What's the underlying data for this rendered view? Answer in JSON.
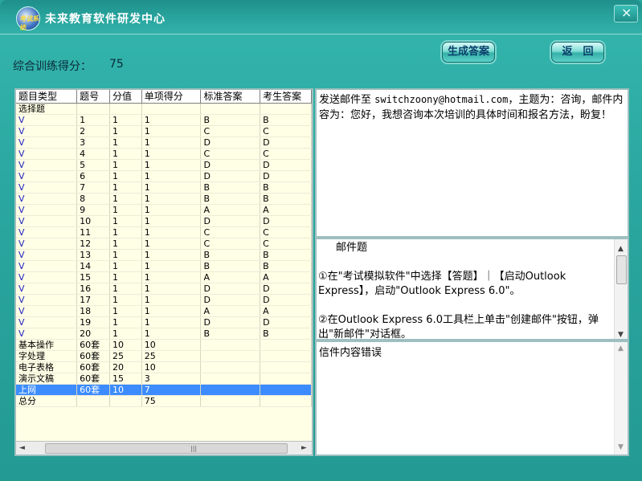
{
  "window": {
    "title": "未来教育软件研发中心",
    "logo_text": "考试系统",
    "close": "×"
  },
  "toolbar": {
    "generate_label": "生成答案",
    "back_label": "返　回"
  },
  "score": {
    "label": "综合训练得分：",
    "value": "75"
  },
  "table": {
    "columns": [
      "题目类型",
      "题号",
      "分值",
      "单项得分",
      "标准答案",
      "考生答案"
    ],
    "rows": [
      [
        "选择题",
        "",
        "",
        "",
        "",
        ""
      ],
      [
        "V",
        "1",
        "1",
        "1",
        "B",
        "B"
      ],
      [
        "V",
        "2",
        "1",
        "1",
        "C",
        "C"
      ],
      [
        "V",
        "3",
        "1",
        "1",
        "D",
        "D"
      ],
      [
        "V",
        "4",
        "1",
        "1",
        "C",
        "C"
      ],
      [
        "V",
        "5",
        "1",
        "1",
        "D",
        "D"
      ],
      [
        "V",
        "6",
        "1",
        "1",
        "D",
        "D"
      ],
      [
        "V",
        "7",
        "1",
        "1",
        "B",
        "B"
      ],
      [
        "V",
        "8",
        "1",
        "1",
        "B",
        "B"
      ],
      [
        "V",
        "9",
        "1",
        "1",
        "A",
        "A"
      ],
      [
        "V",
        "10",
        "1",
        "1",
        "D",
        "D"
      ],
      [
        "V",
        "11",
        "1",
        "1",
        "C",
        "C"
      ],
      [
        "V",
        "12",
        "1",
        "1",
        "C",
        "C"
      ],
      [
        "V",
        "13",
        "1",
        "1",
        "B",
        "B"
      ],
      [
        "V",
        "14",
        "1",
        "1",
        "B",
        "B"
      ],
      [
        "V",
        "15",
        "1",
        "1",
        "A",
        "A"
      ],
      [
        "V",
        "16",
        "1",
        "1",
        "D",
        "D"
      ],
      [
        "V",
        "17",
        "1",
        "1",
        "D",
        "D"
      ],
      [
        "V",
        "18",
        "1",
        "1",
        "A",
        "A"
      ],
      [
        "V",
        "19",
        "1",
        "1",
        "D",
        "D"
      ],
      [
        "V",
        "20",
        "1",
        "1",
        "B",
        "B"
      ],
      [
        "基本操作",
        "60套",
        "10",
        "10",
        "",
        ""
      ],
      [
        "字处理",
        "60套",
        "25",
        "25",
        "",
        ""
      ],
      [
        "电子表格",
        "60套",
        "20",
        "10",
        "",
        ""
      ],
      [
        "演示文稿",
        "60套",
        "15",
        "3",
        "",
        ""
      ],
      [
        "上网",
        "60套",
        "10",
        "7",
        "",
        ""
      ],
      [
        "总分",
        "",
        "",
        "75",
        "",
        ""
      ]
    ],
    "selected_row": 25
  },
  "question": {
    "part1": "发送邮件至 ",
    "email": "switchzoony@hotmail.com",
    "part2": "，主题为：咨询，邮件内容为：您好，我想咨询本次培训的具体时间和报名方法，盼复！"
  },
  "guide": {
    "title": "邮件题",
    "steps": [
      "①在\"考试模拟软件\"中选择【答题】｜【启动Outlook Express】，启动\"Outlook Express 6.0\"。",
      "②在Outlook Express 6.0工具栏上单击\"创建邮件\"按钮，弹出\"新邮件\"对话框。"
    ]
  },
  "result": {
    "text": "信件内容错误"
  },
  "scroll_glyphs": {
    "left": "◄",
    "right": "►",
    "up": "▲",
    "down": "▼",
    "grip": "|||"
  },
  "colors": {
    "window_bg": "#2aa7a0",
    "grid_bg": "#ffffe6",
    "selection": "#3c8cff",
    "v_mark": "#2020c0"
  }
}
